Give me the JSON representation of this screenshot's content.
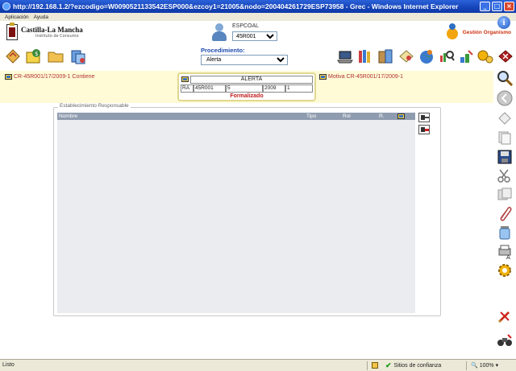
{
  "window": {
    "title": "http://192.168.1.2/?ezcodigo=W0090521133542ESP000&ezcoy1=21005&nodo=200404261729ESP73958 - Grec - Windows Internet Explorer",
    "min_glyph": "_",
    "max_glyph": "□",
    "close_glyph": "×"
  },
  "menubar": {
    "items": [
      "Aplicación",
      "Ayuda"
    ]
  },
  "header": {
    "logo_name": "Castilla-La Mancha",
    "logo_sub": "Instituto de Consumo",
    "user_label": "ESPCOAL",
    "user_value": "45R001",
    "gestion_label": "Gestión Organismo",
    "info_glyph": "i"
  },
  "toolbar": {
    "procedimiento_label": "Procedimiento:",
    "procedimiento_value": "Alerta"
  },
  "context": {
    "contiene_link": "CR-45R001/17/2009-1 Contiene",
    "motiva_link": "Motiva CR-45R001/17/2009-1",
    "alerta": {
      "title": "ALERTA",
      "cells": [
        "RA",
        "45R001",
        "5",
        "2009",
        "1"
      ],
      "status": "Formalizado"
    }
  },
  "establecimiento": {
    "legend": "Establecimiento Responsable",
    "columns": [
      "Nombre",
      "Tipo",
      "Rol",
      "R."
    ]
  },
  "statusbar": {
    "text": "Listo",
    "trusted": "Sitios de confianza",
    "zoom": "100%",
    "check_glyph": "✔",
    "zoom_glyph": "🔍",
    "caret_glyph": "▾"
  },
  "colors": {
    "titlebar": "#1543b8",
    "context_bg": "#fffbd6",
    "grid_header": "#8f9caf",
    "link_red": "#b03030",
    "status_red": "#c01a1a",
    "proc_blue": "#1b49b0"
  }
}
